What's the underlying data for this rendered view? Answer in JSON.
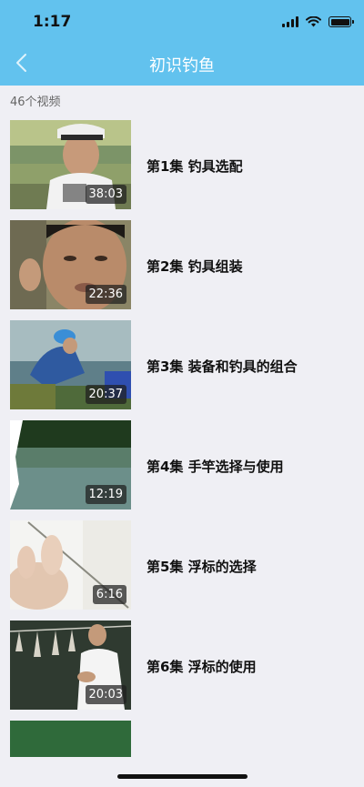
{
  "status_bar": {
    "time": "1:17",
    "icons": [
      "signal-icon",
      "wifi-icon",
      "battery-icon"
    ]
  },
  "nav": {
    "back_icon": "chevron-left-icon",
    "title": "初识钓鱼"
  },
  "colors": {
    "header_bg": "#62c2ee",
    "page_bg": "#efeff4"
  },
  "video_count": "46个视频",
  "videos": [
    {
      "title": "第1集 钓具选配",
      "duration": "38:03"
    },
    {
      "title": "第2集 钓具组装",
      "duration": "22:36"
    },
    {
      "title": "第3集 装备和钓具的组合",
      "duration": "20:37"
    },
    {
      "title": "第4集 手竿选择与使用",
      "duration": "12:19"
    },
    {
      "title": "第5集 浮标的选择",
      "duration": "6:16"
    },
    {
      "title": "第6集 浮标的使用",
      "duration": "20:03"
    }
  ]
}
